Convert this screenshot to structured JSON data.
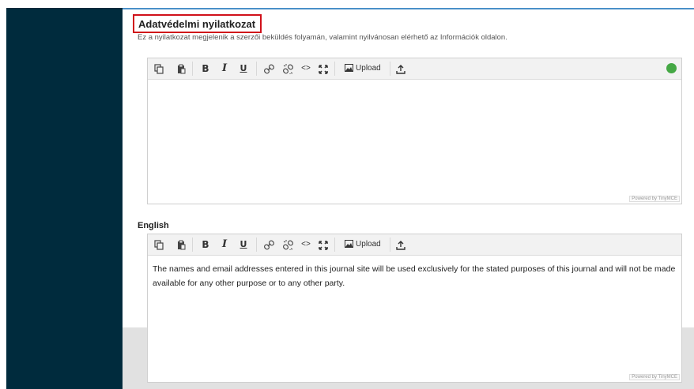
{
  "section": {
    "title": "Adatvédelmi nyilatkozat",
    "description": "Ez a nyilatkozat megjelenik a szerzői beküldés folyamán, valamint nyilvánosan elérhető az Információk oldalon."
  },
  "toolbar": {
    "items": [
      {
        "icon": "copy-icon"
      },
      {
        "icon": "paste-icon"
      },
      {
        "label": "B",
        "icon": "bold-icon"
      },
      {
        "label": "I",
        "icon": "italic-icon"
      },
      {
        "label": "U",
        "icon": "underline-icon"
      },
      {
        "icon": "link-icon"
      },
      {
        "icon": "unlink-icon"
      },
      {
        "label": "<>",
        "icon": "code-icon"
      },
      {
        "icon": "fullscreen-icon"
      },
      {
        "label": "Upload",
        "icon": "image-upload-icon"
      },
      {
        "icon": "upload-icon"
      }
    ],
    "upload_label": "Upload"
  },
  "editors": [
    {
      "language": "",
      "content": "",
      "status_color": "#45a845",
      "powered_by": "Powered by TinyMCE"
    },
    {
      "language": "English",
      "content": "The names and email addresses entered in this journal site will be used exclusively for the stated purposes of this journal and will not be made available for any other purpose or to any other party.",
      "powered_by": "Powered by TinyMCE"
    }
  ],
  "colors": {
    "sidebar": "#002b3d",
    "highlight_border": "#d0101a",
    "status_ok": "#45a845"
  }
}
